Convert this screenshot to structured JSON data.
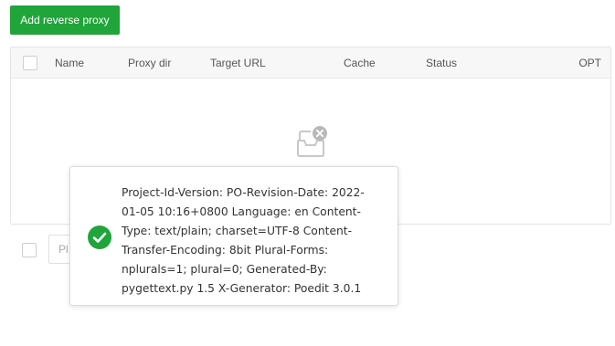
{
  "toolbar": {
    "add_button_label": "Add reverse proxy"
  },
  "table": {
    "columns": {
      "name": "Name",
      "proxy_dir": "Proxy dir",
      "target_url": "Target URL",
      "cache": "Cache",
      "status": "Status",
      "opt": "OPT"
    },
    "rows": []
  },
  "footer": {
    "page_input_placeholder": "Pl"
  },
  "toast": {
    "status": "success",
    "message": "Project-Id-Version: PO-Revision-Date: 2022-01-05 10:16+0800 Language: en Content-Type: text/plain; charset=UTF-8 Content-Transfer-Encoding: 8bit Plural-Forms: nplurals=1; plural=0; Generated-By: pygettext.py 1.5 X-Generator: Poedit 3.0.1"
  },
  "colors": {
    "primary": "#20a53a",
    "success": "#20a53a",
    "empty_icon": "#c8c8c8"
  },
  "icons": {
    "empty": "empty-inbox-icon",
    "toast": "check-circle-icon"
  }
}
